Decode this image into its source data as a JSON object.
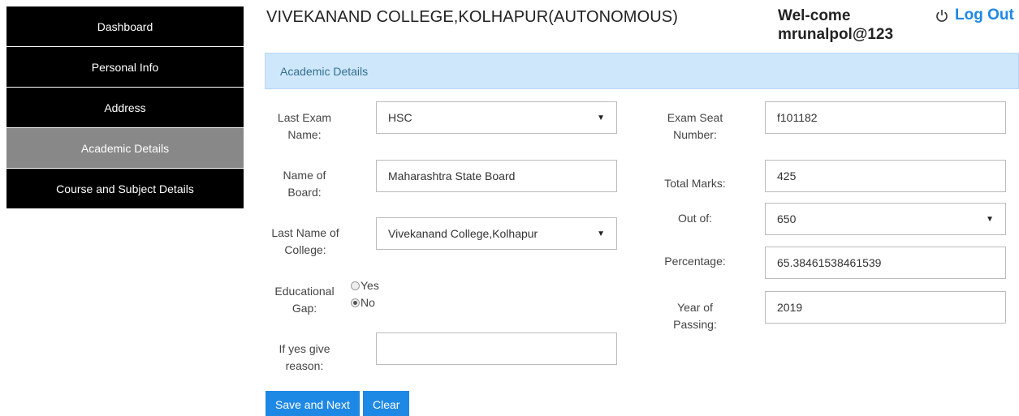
{
  "sidebar": {
    "items": [
      {
        "label": "Dashboard",
        "active": false
      },
      {
        "label": "Personal Info",
        "active": false
      },
      {
        "label": "Address",
        "active": false
      },
      {
        "label": "Academic Details",
        "active": true
      },
      {
        "label": "Course and Subject Details",
        "active": false
      }
    ]
  },
  "header": {
    "college": "VIVEKANAND COLLEGE,KOLHAPUR(AUTONOMOUS)",
    "welcome": "Wel-come",
    "username": "mrunalpol@123",
    "logout": "Log Out"
  },
  "panel": {
    "title": "Academic Details"
  },
  "form": {
    "last_exam_label": "Last Exam Name:",
    "last_exam_value": "HSC",
    "board_label": "Name of Board:",
    "board_value": "Maharashtra State Board",
    "college_label": "Last Name of College:",
    "college_value": "Vivekanand College,Kolhapur",
    "gap_label": "Educational Gap:",
    "gap_yes": "Yes",
    "gap_no": "No",
    "gap_selected": "No",
    "reason_label": "If yes give reason:",
    "reason_value": "",
    "seat_label": "Exam Seat Number:",
    "seat_value": "f101182",
    "total_label": "Total Marks:",
    "total_value": "425",
    "outof_label": "Out of:",
    "outof_value": "650",
    "percent_label": "Percentage:",
    "percent_value": "65.38461538461539",
    "year_label": "Year of Passing:",
    "year_value": "2019"
  },
  "buttons": {
    "save": "Save and Next",
    "clear": "Clear"
  },
  "colors": {
    "accent": "#1e88e5",
    "sidebar_bg": "#000000",
    "sidebar_active": "#888888",
    "panel_bg": "#cfe7fb"
  }
}
